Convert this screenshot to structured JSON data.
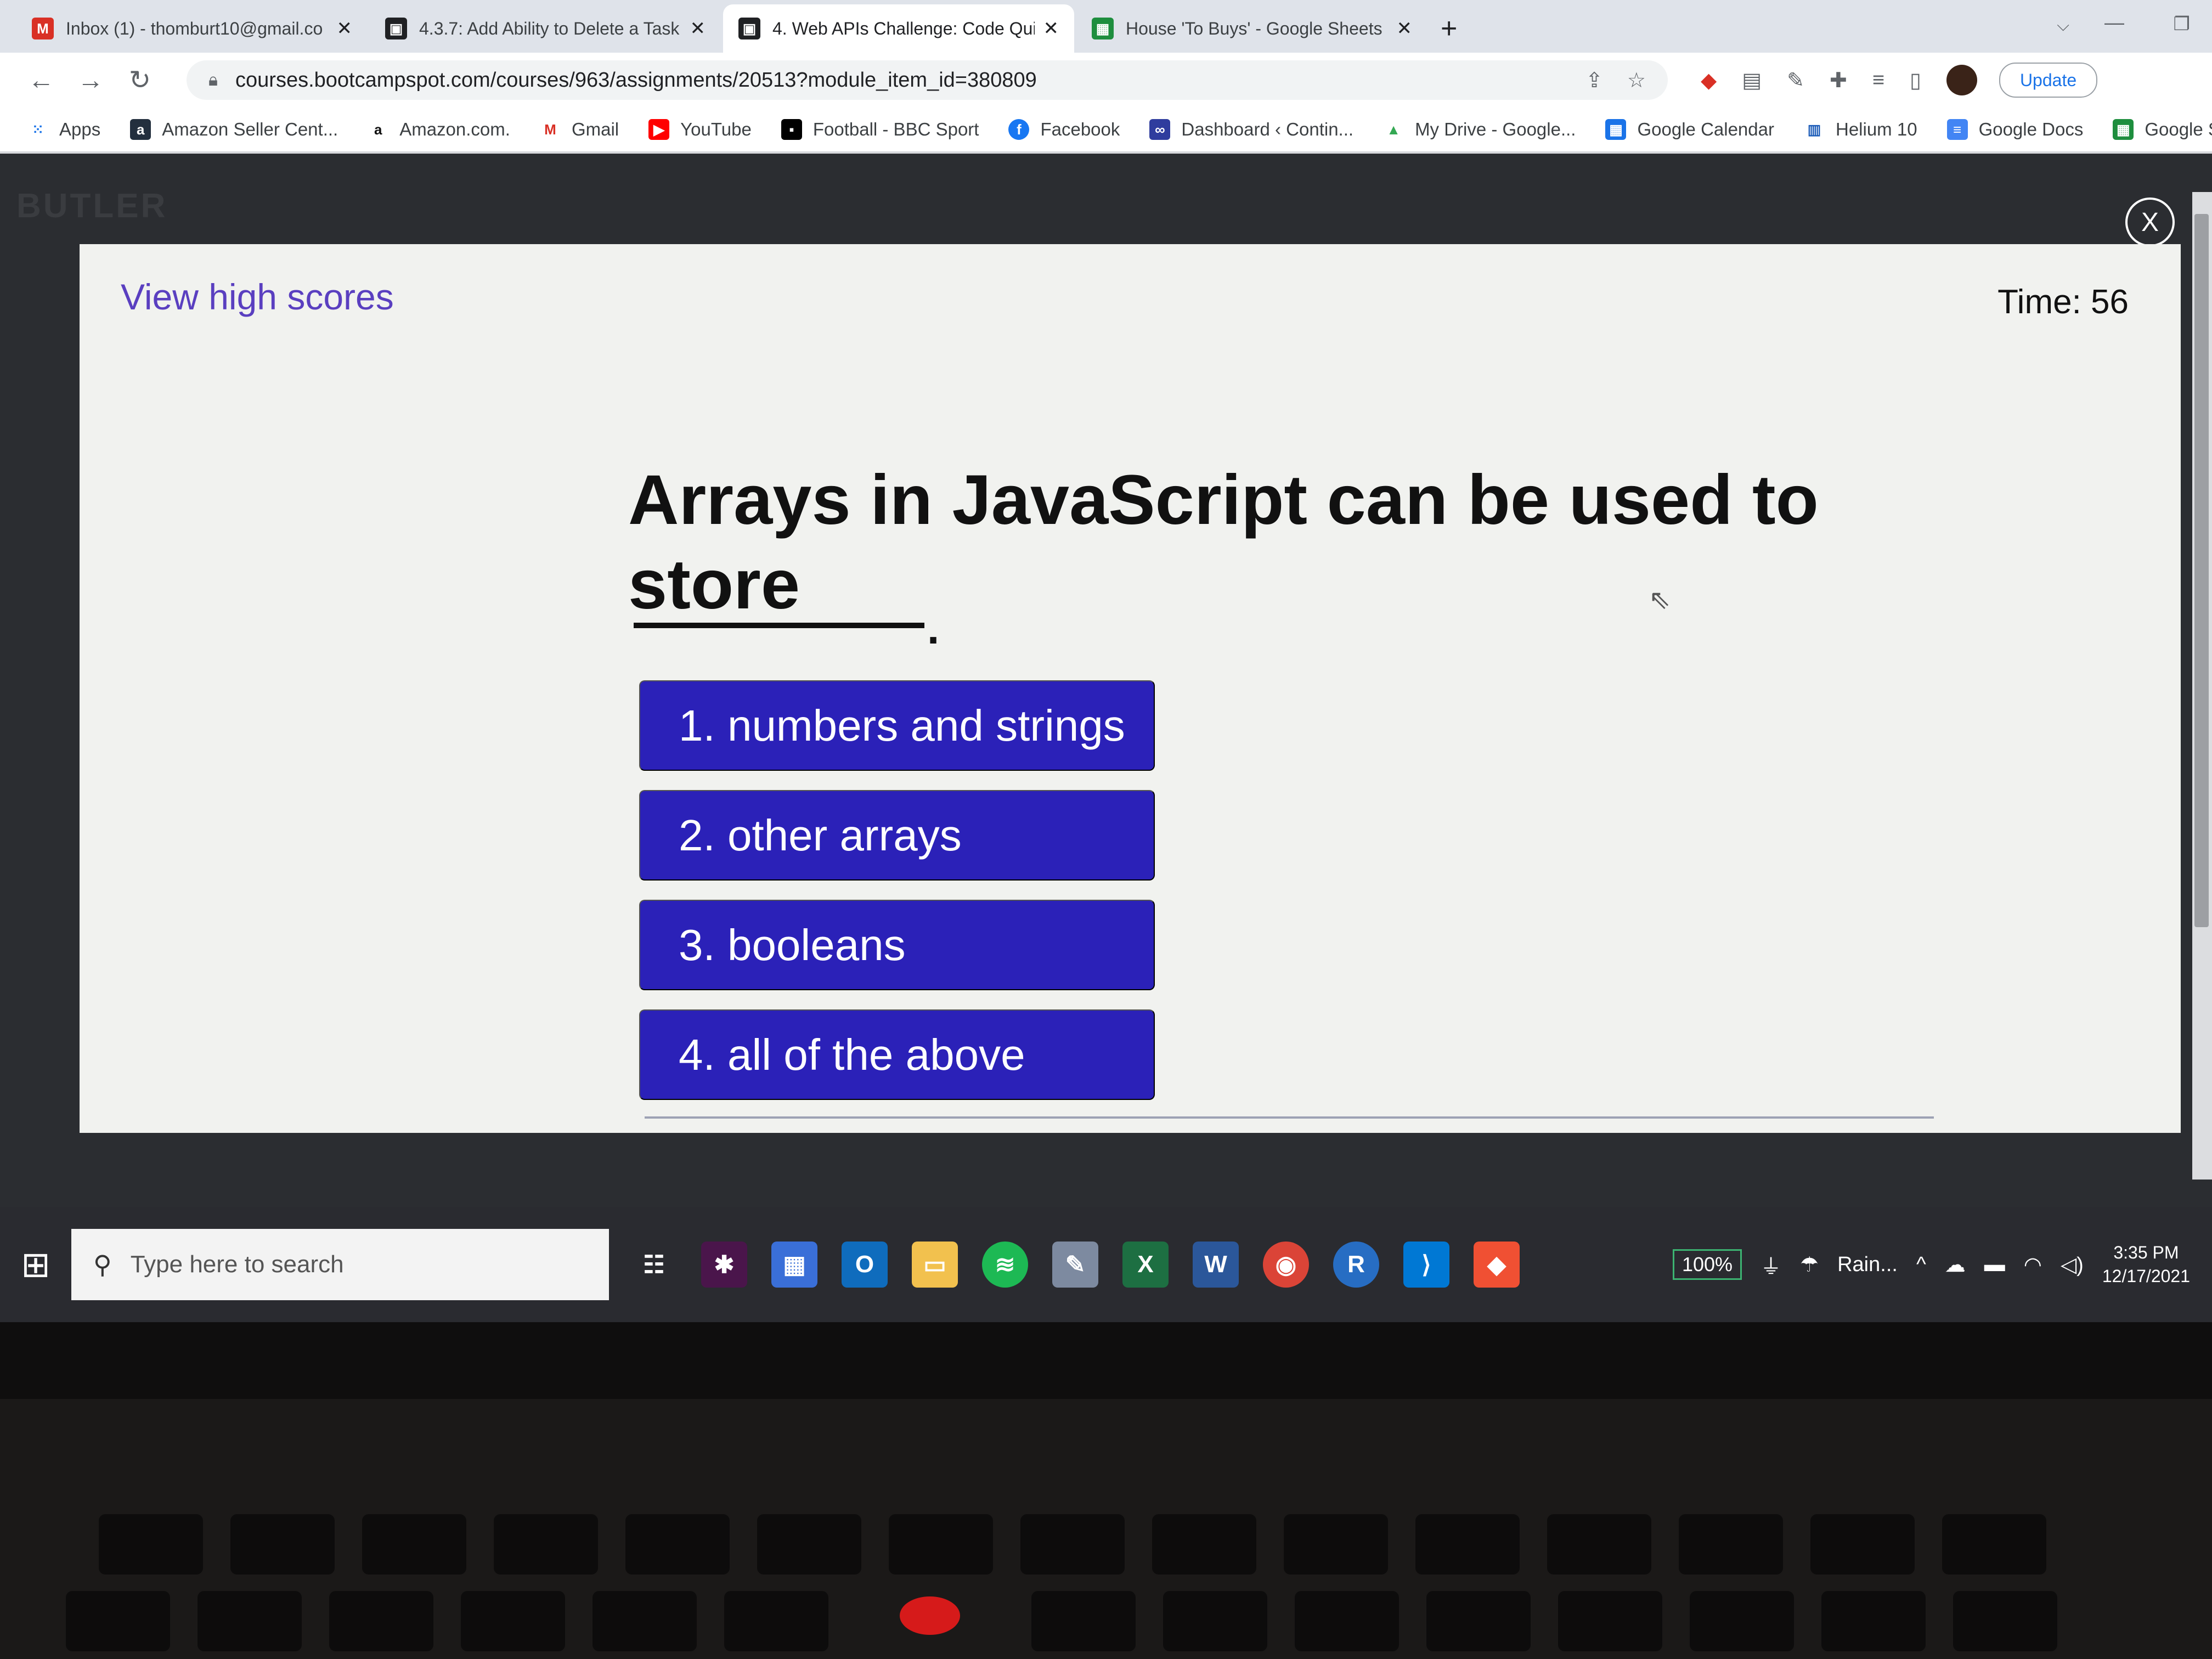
{
  "browser": {
    "tabs": [
      {
        "title": "Inbox (1) - thomburt10@gmail.co",
        "icon": "gmail-icon",
        "color": "#d93025",
        "active": false
      },
      {
        "title": "4.3.7: Add Ability to Delete a Task",
        "icon": "bootcamp-icon",
        "color": "#202124",
        "active": false
      },
      {
        "title": "4. Web APIs Challenge: Code Qui",
        "icon": "bootcamp-icon",
        "color": "#202124",
        "active": true
      },
      {
        "title": "House 'To Buys' - Google Sheets",
        "icon": "sheets-icon",
        "color": "#1e8e3e",
        "active": false
      }
    ],
    "new_tab": "+",
    "url": "courses.bootcampspot.com/courses/963/assignments/20513?module_item_id=380809",
    "update_label": "Update",
    "bookmarks": [
      {
        "label": "Apps",
        "icon": "apps-icon",
        "color": "#1a73e8"
      },
      {
        "label": "Amazon Seller Cent...",
        "icon": "amazon-icon",
        "color": "#232f3e"
      },
      {
        "label": "Amazon.com.",
        "icon": "amazon-icon",
        "color": "#ffffff"
      },
      {
        "label": "Gmail",
        "icon": "gmail-icon",
        "color": "#d93025"
      },
      {
        "label": "YouTube",
        "icon": "youtube-icon",
        "color": "#ff0000"
      },
      {
        "label": "Football - BBC Sport",
        "icon": "bbc-icon",
        "color": "#000000"
      },
      {
        "label": "Facebook",
        "icon": "facebook-icon",
        "color": "#1877f2"
      },
      {
        "label": "Dashboard ‹ Contin...",
        "icon": "dashboard-icon",
        "color": "#2f3d9e"
      },
      {
        "label": "My Drive - Google...",
        "icon": "drive-icon",
        "color": "#34a853"
      },
      {
        "label": "Google Calendar",
        "icon": "calendar-icon",
        "color": "#1a73e8"
      },
      {
        "label": "Helium 10",
        "icon": "helium-icon",
        "color": "#1a5bb8"
      },
      {
        "label": "Google Docs",
        "icon": "docs-icon",
        "color": "#4285f4"
      },
      {
        "label": "Google Sheets",
        "icon": "sheets-icon",
        "color": "#1e8e3e"
      }
    ]
  },
  "lms": {
    "logo": "BUTLER",
    "close_label": "X"
  },
  "quiz": {
    "high_scores_label": "View high scores",
    "timer": "Time: 56",
    "question": "Arrays in JavaScript can be used to store",
    "blank_period": ".",
    "choices": [
      {
        "label": "1.  numbers and strings"
      },
      {
        "label": "2. other arrays"
      },
      {
        "label": "3. booleans"
      },
      {
        "label": "4. all of the above"
      }
    ],
    "accent_color": "#2b21b8",
    "link_color": "#5a3fc0"
  },
  "taskbar": {
    "search_placeholder": "Type here to search",
    "battery": "100%",
    "weather": "Rain...",
    "time": "3:35 PM",
    "date": "12/17/2021",
    "apps": [
      {
        "icon": "task-view-icon",
        "color": "#2a2b30"
      },
      {
        "icon": "slack-icon",
        "color": "#4a154b"
      },
      {
        "icon": "calculator-icon",
        "color": "#3a6fd8"
      },
      {
        "icon": "outlook-icon",
        "color": "#0f6cbd"
      },
      {
        "icon": "file-explorer-icon",
        "color": "#f2c14e"
      },
      {
        "icon": "spotify-icon",
        "color": "#1db954"
      },
      {
        "icon": "paint-icon",
        "color": "#7d8aa0"
      },
      {
        "icon": "excel-icon",
        "color": "#1d6f42"
      },
      {
        "icon": "word-icon",
        "color": "#2b579a"
      },
      {
        "icon": "chrome-icon",
        "color": "#db4437"
      },
      {
        "icon": "r-icon",
        "color": "#276dc3"
      },
      {
        "icon": "vscode-icon",
        "color": "#0078d4"
      },
      {
        "icon": "git-icon",
        "color": "#f05033"
      }
    ]
  }
}
